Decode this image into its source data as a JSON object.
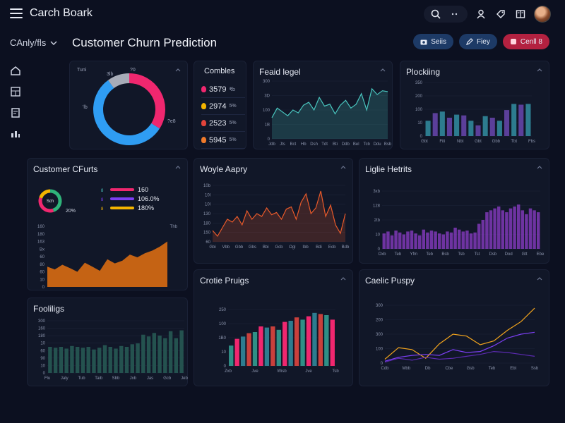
{
  "header": {
    "app_title": "Carch Boark",
    "subnav_label": "CAnly/fls",
    "page_title": "Customer Churn Prediction",
    "buttons": [
      {
        "label": "Seiis",
        "color": "#1d3a66"
      },
      {
        "label": "Fiey",
        "color": "#1d3a66"
      },
      {
        "label": "Cenll 8",
        "color": "#b32140"
      }
    ]
  },
  "donut_card": {
    "labels": {
      "tl": "Tuni",
      "tr": "?0",
      "left": "'lb",
      "top": "3lb",
      "br": "?e8"
    },
    "chart_data": {
      "type": "pie",
      "values": [
        34,
        56,
        10
      ],
      "colors": [
        "#f0276f",
        "#2f9df3",
        "#a7acb8"
      ]
    }
  },
  "combines_card": {
    "title": "Combles",
    "rows": [
      {
        "value": "3579",
        "suffix": "₹b",
        "color": "#f0276f"
      },
      {
        "value": "2974",
        "suffix": "5%",
        "color": "#f4b400"
      },
      {
        "value": "2523",
        "suffix": "5%",
        "color": "#e2443b"
      },
      {
        "value": "5945",
        "suffix": "5%",
        "color": "#f07a2a"
      }
    ]
  },
  "charts": {
    "feaid": {
      "title": "Feaid legel",
      "chart_data": {
        "type": "area",
        "ylabels": [
          "300",
          "3D",
          "100",
          "1B",
          "0"
        ],
        "xlabels": [
          "Jdb",
          "Jts",
          "Bct",
          "Hb",
          "Dsh",
          "Tdt",
          "Bti",
          "Ddb",
          "Bel",
          "Tcb",
          "Ddu",
          "Bsb"
        ],
        "color": "#49c6bf",
        "ylim": [
          0,
          300
        ],
        "values": [
          110,
          160,
          140,
          120,
          150,
          135,
          175,
          190,
          150,
          215,
          170,
          180,
          130,
          175,
          200,
          160,
          180,
          235,
          150,
          260,
          230,
          250,
          245
        ]
      }
    },
    "plocking": {
      "title": "Plockiing",
      "chart_data": {
        "type": "bar",
        "ylabels": [
          "350",
          "200",
          "100",
          "10",
          "0"
        ],
        "xlabels": [
          "Gbt",
          "Fiti",
          "Nbt",
          "Gbt",
          "Gbb",
          "Tbt",
          "Fbs"
        ],
        "ylim": [
          0,
          350
        ],
        "colors": [
          "#2d7c8f",
          "#5b3f9a"
        ],
        "values": [
          100,
          150,
          160,
          120,
          140,
          135,
          100,
          70,
          130,
          120,
          100,
          170,
          210,
          205,
          210
        ]
      }
    },
    "customer": {
      "title": "Customer CFurts",
      "mini_donut": {
        "label": "Sch",
        "values": [
          45,
          35,
          20
        ],
        "colors": [
          "#2fb37a",
          "#f0276f",
          "#f4b400"
        ]
      },
      "pct": "20%",
      "legend": [
        {
          "tag": "8",
          "value": "160",
          "color": "#f0276f",
          "color2": "#49c6bf"
        },
        {
          "tag": "8",
          "value": "106.0%",
          "color": "#7b3ff2",
          "color2": "#7b3ff2"
        },
        {
          "tag": "8",
          "value": "180%",
          "color": "#f4b400",
          "color2": "#f4b400"
        }
      ],
      "chart_data": {
        "type": "area",
        "ylabels": [
          "160",
          "180",
          "163",
          "Bx",
          "60",
          "80",
          "60",
          "10",
          "0"
        ],
        "top_right": "Thb",
        "ylim": [
          0,
          180
        ],
        "color": "#d96c12",
        "values": [
          60,
          52,
          66,
          56,
          45,
          72,
          60,
          48,
          82,
          70,
          78,
          96,
          88,
          100,
          108,
          120,
          135
        ]
      }
    },
    "woyle": {
      "title": "Woyle Aapry",
      "chart_data": {
        "type": "line",
        "ylabels": [
          "10b",
          "10l",
          "10l",
          "130",
          "180",
          "150",
          "60"
        ],
        "xlabels": [
          "Gbi",
          "Vbb",
          "Gbb",
          "Gbs",
          "Bbi",
          "Gcb",
          "Ogl",
          "Ibb",
          "Bdi",
          "Eob",
          "Bdb"
        ],
        "color": "#ea5a2a",
        "ylim": [
          0,
          100
        ],
        "values": [
          20,
          10,
          25,
          40,
          35,
          45,
          30,
          55,
          40,
          50,
          45,
          60,
          48,
          52,
          40,
          58,
          62,
          40,
          70,
          85,
          50,
          60,
          90,
          45,
          65,
          30,
          15,
          50
        ]
      }
    },
    "lipte": {
      "title": "Liglie Hetrits",
      "chart_data": {
        "type": "bar",
        "ylabels": [
          "3xb",
          "128",
          "2tb",
          "10",
          "0"
        ],
        "xlabels": [
          "Oxb",
          "Teb",
          "Yfm",
          "Teb",
          "Bsb",
          "Tsb",
          "Tst",
          "Dsb",
          "Dod",
          "Gtt",
          "Ebe"
        ],
        "color": "#8d3dc9",
        "ylim": [
          0,
          300
        ],
        "values": [
          80,
          90,
          70,
          95,
          85,
          75,
          90,
          95,
          80,
          70,
          100,
          85,
          95,
          90,
          80,
          75,
          90,
          85,
          110,
          100,
          90,
          95,
          80,
          85,
          130,
          150,
          190,
          200,
          210,
          220,
          200,
          190,
          210,
          220,
          230,
          200,
          180,
          210,
          200,
          190
        ]
      }
    },
    "pooling": {
      "title": "Fooliligs",
      "chart_data": {
        "type": "bar",
        "ylabels": [
          "300",
          "160",
          "180",
          "10",
          "60",
          "90",
          "10",
          "0"
        ],
        "xlabels": [
          "Flu",
          "Jaly",
          "Tub",
          "Taib",
          "Sbb",
          "Jxb",
          "Jas",
          "Gcb",
          "Jeb"
        ],
        "color": "#24524f",
        "ylim": [
          0,
          300
        ],
        "values": [
          150,
          145,
          150,
          140,
          155,
          150,
          145,
          150,
          135,
          145,
          160,
          150,
          140,
          155,
          150,
          165,
          170,
          220,
          210,
          230,
          215,
          200,
          240,
          200,
          245
        ]
      }
    },
    "crone": {
      "title": "Crotie Pruigs",
      "chart_data": {
        "type": "bar",
        "ylabels": [
          "250",
          "100",
          "1B0",
          "10",
          "0"
        ],
        "xlabels": [
          "Zxb",
          "Jve",
          "Wisb",
          "Jve",
          "Tsb"
        ],
        "ylim": [
          0,
          250
        ],
        "colors": [
          "#2f8f86",
          "#f0276f",
          "#2d7c8f",
          "#c9403c"
        ],
        "values": [
          90,
          120,
          130,
          145,
          150,
          175,
          170,
          175,
          160,
          195,
          200,
          215,
          205,
          220,
          235,
          230,
          225,
          205
        ]
      }
    },
    "coelic": {
      "title": "Caelic Puspy",
      "chart_data": {
        "type": "line",
        "ylabels": [
          "300",
          "200",
          "300",
          "100",
          "0"
        ],
        "xlabels": [
          "Cdb",
          "Mbb",
          "Db",
          "Cbe",
          "Gsb",
          "Teb",
          "Ebt",
          "Ssb"
        ],
        "ylim": [
          0,
          300
        ],
        "series": [
          {
            "color": "#f4a51c",
            "values": [
              20,
              80,
              70,
              25,
              100,
              150,
              140,
              95,
              115,
              170,
              215,
              285
            ]
          },
          {
            "color": "#7b3ff2",
            "values": [
              10,
              30,
              40,
              45,
              40,
              70,
              55,
              60,
              90,
              130,
              150,
              160
            ]
          },
          {
            "color": "#5b2ab0",
            "values": [
              5,
              25,
              15,
              30,
              20,
              25,
              35,
              45,
              60,
              55,
              45,
              35
            ]
          }
        ]
      }
    }
  }
}
